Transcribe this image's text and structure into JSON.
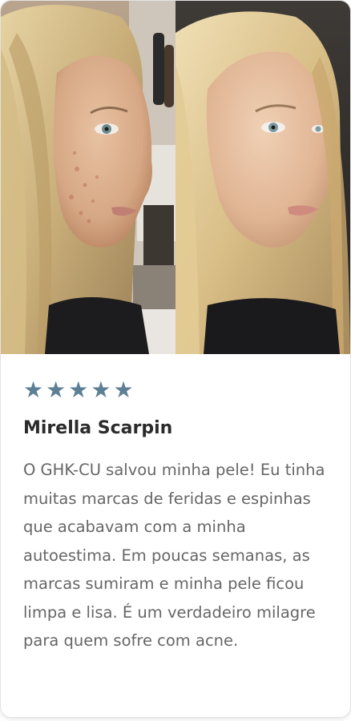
{
  "review": {
    "rating": 5,
    "stars": [
      "★",
      "★",
      "★",
      "★",
      "★"
    ],
    "star_color": "#5d7f96",
    "name": "Mirella Scarpin",
    "text": "O GHK-CU salvou minha pele! Eu tinha muitas marcas de feridas e espinhas que acabavam com a minha autoestima. Em poucas semanas, as marcas sumiram e minha pele ficou limpa e lisa. É um verdadeiro milagre para quem sofre com acne."
  },
  "photos": {
    "before": "before-photo",
    "after": "after-photo"
  }
}
